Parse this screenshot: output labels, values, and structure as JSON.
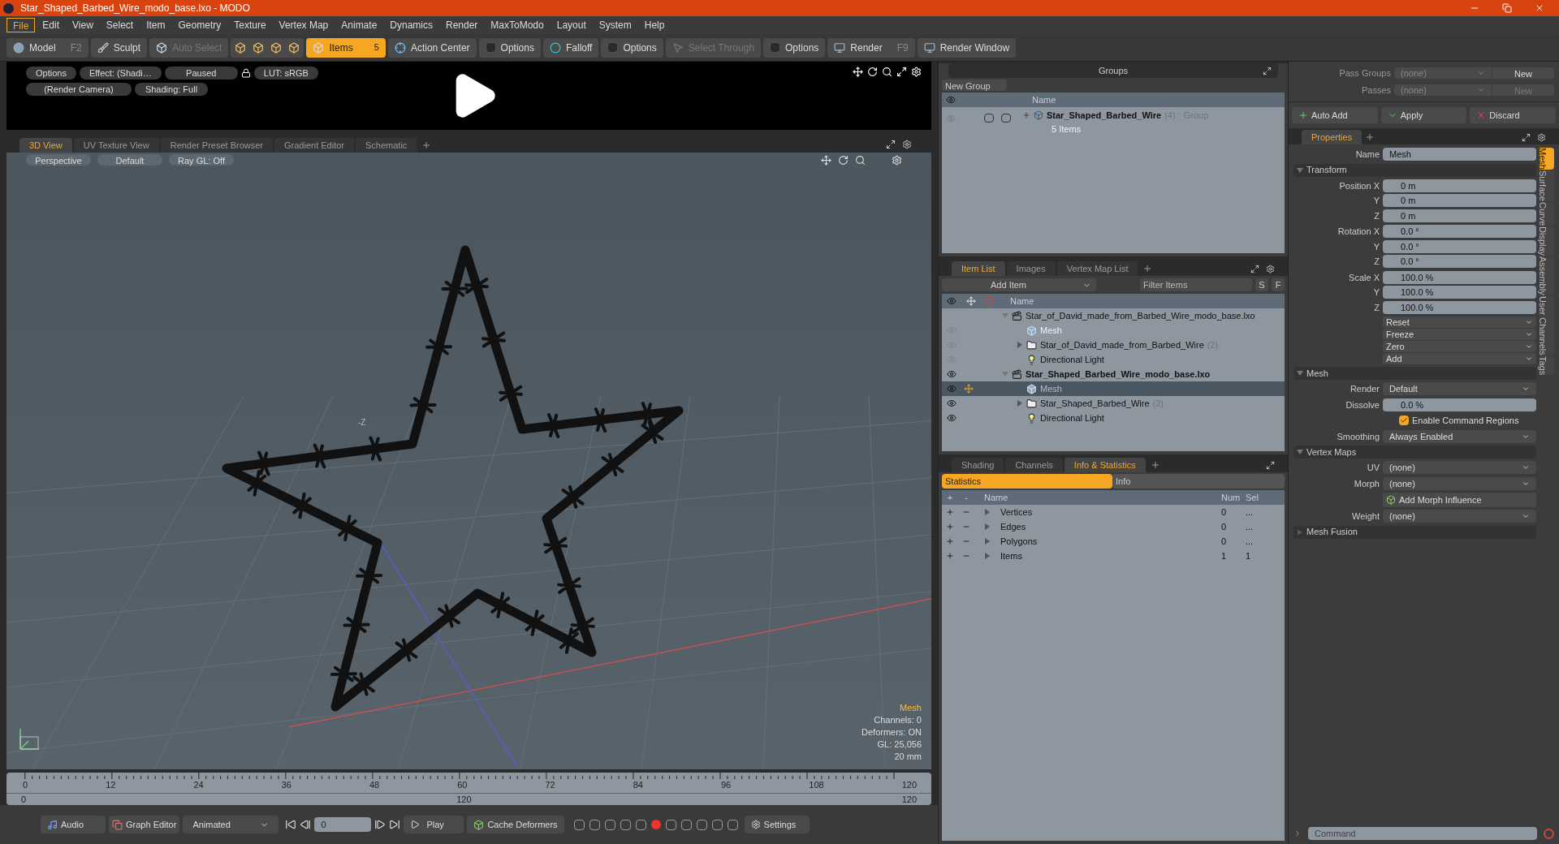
{
  "window": {
    "title": "Star_Shaped_Barbed_Wire_modo_base.lxo - MODO"
  },
  "menu": [
    {
      "label": "File",
      "selected": true
    },
    {
      "label": "Edit",
      "selected": false
    },
    {
      "label": "View",
      "selected": false
    },
    {
      "label": "Select",
      "selected": false
    },
    {
      "label": "Item",
      "selected": false
    },
    {
      "label": "Geometry",
      "selected": false
    },
    {
      "label": "Texture",
      "selected": false
    },
    {
      "label": "Vertex Map",
      "selected": false
    },
    {
      "label": "Animate",
      "selected": false
    },
    {
      "label": "Dynamics",
      "selected": false
    },
    {
      "label": "Render",
      "selected": false
    },
    {
      "label": "MaxToModo",
      "selected": false
    },
    {
      "label": "Layout",
      "selected": false
    },
    {
      "label": "System",
      "selected": false
    },
    {
      "label": "Help",
      "selected": false
    }
  ],
  "toolbar": [
    {
      "kind": "sphere",
      "label": "Model",
      "shortcut": "F2",
      "selected": false,
      "disabled": false
    },
    {
      "kind": "brush",
      "label": "Sculpt",
      "selected": false,
      "disabled": false
    },
    {
      "kind": "cube",
      "label": "Auto Select",
      "selected": false,
      "disabled": true
    },
    {
      "kind": "cubes"
    },
    {
      "kind": "cube",
      "label": "Items",
      "badge": "5",
      "selected": true,
      "disabled": false
    },
    {
      "kind": "target",
      "label": "Action Center",
      "selected": false,
      "disabled": false
    },
    {
      "kind": "box",
      "label": "Options",
      "selected": false,
      "disabled": false
    },
    {
      "kind": "falloff",
      "label": "Falloff",
      "selected": false,
      "disabled": false
    },
    {
      "kind": "box",
      "label": "Options",
      "selected": false,
      "disabled": false
    },
    {
      "kind": "select",
      "label": "Select Through",
      "selected": false,
      "disabled": true
    },
    {
      "kind": "box",
      "label": "Options",
      "selected": false,
      "disabled": false
    },
    {
      "kind": "render",
      "label": "Render",
      "shortcut": "F9",
      "selected": false,
      "disabled": false
    },
    {
      "kind": "render",
      "label": "Render Window",
      "selected": false,
      "disabled": false
    }
  ],
  "preview": {
    "row1": [
      "Options",
      "Effect: (Shadi…",
      "Paused",
      "LUT: sRGB"
    ],
    "row2": [
      "(Render Camera)",
      "Shading: Full"
    ]
  },
  "viewport_tabs": [
    {
      "label": "3D View",
      "selected": true
    },
    {
      "label": "UV Texture View",
      "selected": false
    },
    {
      "label": "Render Preset Browser",
      "selected": false
    },
    {
      "label": "Gradient Editor",
      "selected": false
    },
    {
      "label": "Schematic",
      "selected": false
    }
  ],
  "viewport": {
    "header": [
      "Perspective",
      "Default",
      "Ray GL: Off"
    ],
    "axis_label": "-Z",
    "info_title": "Mesh",
    "info_lines": [
      "Channels: 0",
      "Deformers: ON",
      "GL: 25,056",
      "20 mm"
    ]
  },
  "timeline": {
    "ticks": [
      "0",
      "12",
      "24",
      "36",
      "48",
      "60",
      "72",
      "84",
      "96",
      "108",
      "120"
    ],
    "range": [
      "0",
      "120",
      "120"
    ]
  },
  "bottom_bar": {
    "audio": "Audio",
    "graph": "Graph Editor",
    "mode": "Animated",
    "frame": "0",
    "play": "Play",
    "cache": "Cache Deformers",
    "settings": "Settings"
  },
  "groups": {
    "title": "Groups",
    "new_button": "New Group",
    "column": "Name",
    "rows": [
      {
        "name": "Star_Shaped_Barbed_Wire",
        "count": "(4)",
        "type": ": Group",
        "sub": "5 Items"
      }
    ]
  },
  "item_list": {
    "tabs": [
      {
        "label": "Item List",
        "selected": true
      },
      {
        "label": "Images",
        "selected": false
      },
      {
        "label": "Vertex Map List",
        "selected": false
      }
    ],
    "add": "Add Item",
    "filter": "Filter Items",
    "buttons": [
      "S",
      "F"
    ],
    "column": "Name",
    "items": [
      {
        "kind": "scene",
        "name": "Star_of_David_made_from_Barbed_Wire_modo_base.lxo",
        "current": false,
        "expanded": true,
        "selected": false,
        "children": [
          {
            "kind": "mesh",
            "name": "Mesh",
            "selected": false
          },
          {
            "kind": "group",
            "name": "Star_of_David_made_from_Barbed_Wire",
            "count": "(2)",
            "expanded": false,
            "selected": false
          },
          {
            "kind": "light",
            "name": "Directional Light",
            "selected": false
          }
        ]
      },
      {
        "kind": "scene",
        "name": "Star_Shaped_Barbed_Wire_modo_base.lxo",
        "current": true,
        "expanded": true,
        "selected": false,
        "children": [
          {
            "kind": "mesh",
            "name": "Mesh",
            "selected": true
          },
          {
            "kind": "group",
            "name": "Star_Shaped_Barbed_Wire",
            "count": "(2)",
            "expanded": false,
            "selected": false
          },
          {
            "kind": "light",
            "name": "Directional Light",
            "selected": false
          }
        ]
      }
    ]
  },
  "info_panel": {
    "tabs": [
      {
        "label": "Shading",
        "selected": false
      },
      {
        "label": "Channels",
        "selected": false
      },
      {
        "label": "Info & Statistics",
        "selected": true
      }
    ],
    "subtabs": [
      {
        "label": "Statistics",
        "selected": true
      },
      {
        "label": "Info",
        "selected": false
      }
    ],
    "columns": [
      "+",
      "-",
      "Name",
      "Num",
      "Sel"
    ],
    "rows": [
      {
        "name": "Vertices",
        "num": "0",
        "sel": "..."
      },
      {
        "name": "Edges",
        "num": "0",
        "sel": "..."
      },
      {
        "name": "Polygons",
        "num": "0",
        "sel": "..."
      },
      {
        "name": "Items",
        "num": "1",
        "sel": "1"
      }
    ]
  },
  "passes": [
    {
      "label": "Pass Groups",
      "value": "(none)",
      "button": "New",
      "disabled": false
    },
    {
      "label": "Passes",
      "value": "(none)",
      "button": "New",
      "disabled": true
    }
  ],
  "actions": [
    "Auto Add",
    "Apply",
    "Discard"
  ],
  "properties": {
    "tab": "Properties",
    "name_label": "Name",
    "name_value": "Mesh",
    "side_tabs": [
      {
        "label": "Mesh",
        "selected": true
      },
      {
        "label": "Surface",
        "selected": false
      },
      {
        "label": "Curve",
        "selected": false
      },
      {
        "label": "Display",
        "selected": false
      },
      {
        "label": "Assembly",
        "selected": false
      },
      {
        "label": "User Channels",
        "selected": false
      },
      {
        "label": "Tags",
        "selected": false
      }
    ],
    "sections": [
      {
        "title": "Transform",
        "expanded": true,
        "rows": [
          {
            "kind": "vector",
            "fields": [
              {
                "label": "Position X",
                "value": "0 m"
              },
              {
                "label": "Y",
                "value": "0 m"
              },
              {
                "label": "Z",
                "value": "0 m"
              }
            ]
          },
          {
            "kind": "vector",
            "fields": [
              {
                "label": "Rotation X",
                "value": "0.0 °"
              },
              {
                "label": "Y",
                "value": "0.0 °"
              },
              {
                "label": "Z",
                "value": "0.0 °"
              }
            ]
          },
          {
            "kind": "vector",
            "fields": [
              {
                "label": "Scale X",
                "value": "100.0 %"
              },
              {
                "label": "Y",
                "value": "100.0 %"
              },
              {
                "label": "Z",
                "value": "100.0 %"
              }
            ]
          },
          {
            "kind": "menus",
            "items": [
              "Reset",
              "Freeze",
              "Zero",
              "Add"
            ]
          }
        ]
      },
      {
        "title": "Mesh",
        "expanded": true,
        "rows": [
          {
            "kind": "dropdown",
            "label": "Render",
            "value": "Default"
          },
          {
            "kind": "number",
            "label": "Dissolve",
            "value": "0.0 %"
          },
          {
            "kind": "checkbox",
            "label": "Enable Command Regions",
            "checked": true
          },
          {
            "kind": "dropdown",
            "label": "Smoothing",
            "value": "Always Enabled"
          }
        ]
      },
      {
        "title": "Vertex Maps",
        "expanded": true,
        "rows": [
          {
            "kind": "dropdown",
            "label": "UV",
            "value": "(none)"
          },
          {
            "kind": "dropdown",
            "label": "Morph",
            "value": "(none)"
          },
          {
            "kind": "button",
            "label": "Add Morph Influence"
          },
          {
            "kind": "dropdown",
            "label": "Weight",
            "value": "(none)"
          }
        ]
      },
      {
        "title": "Mesh Fusion",
        "expanded": false
      }
    ]
  },
  "command": {
    "placeholder": "Command"
  }
}
